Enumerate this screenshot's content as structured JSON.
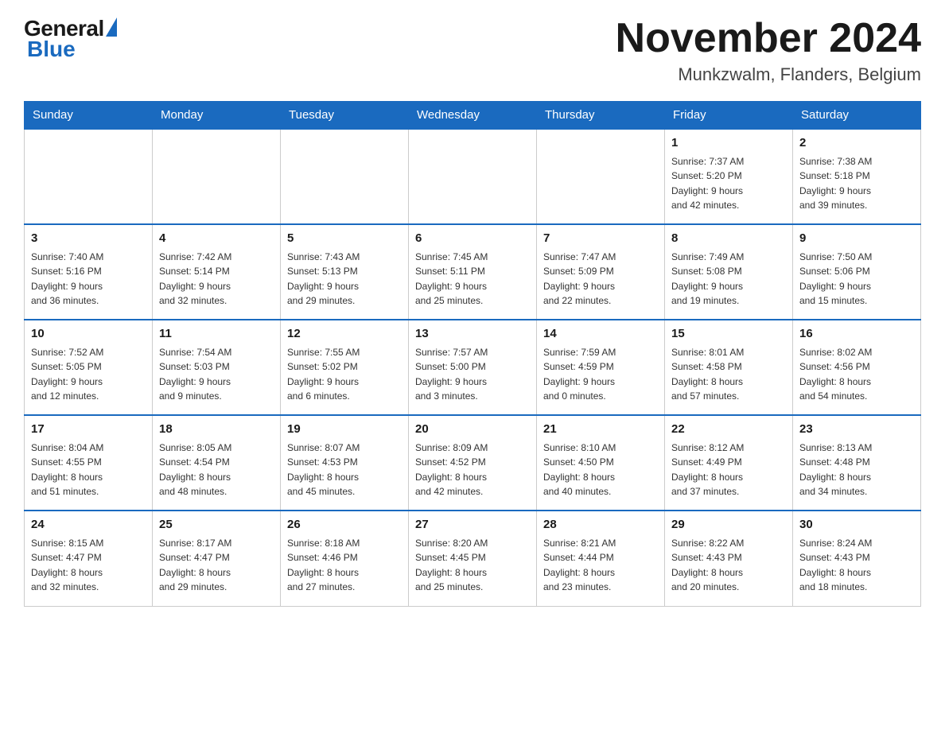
{
  "header": {
    "logo_general": "General",
    "logo_blue": "Blue",
    "month_title": "November 2024",
    "location": "Munkzwalm, Flanders, Belgium"
  },
  "calendar": {
    "days_of_week": [
      "Sunday",
      "Monday",
      "Tuesday",
      "Wednesday",
      "Thursday",
      "Friday",
      "Saturday"
    ],
    "weeks": [
      [
        {
          "day": "",
          "info": ""
        },
        {
          "day": "",
          "info": ""
        },
        {
          "day": "",
          "info": ""
        },
        {
          "day": "",
          "info": ""
        },
        {
          "day": "",
          "info": ""
        },
        {
          "day": "1",
          "info": "Sunrise: 7:37 AM\nSunset: 5:20 PM\nDaylight: 9 hours\nand 42 minutes."
        },
        {
          "day": "2",
          "info": "Sunrise: 7:38 AM\nSunset: 5:18 PM\nDaylight: 9 hours\nand 39 minutes."
        }
      ],
      [
        {
          "day": "3",
          "info": "Sunrise: 7:40 AM\nSunset: 5:16 PM\nDaylight: 9 hours\nand 36 minutes."
        },
        {
          "day": "4",
          "info": "Sunrise: 7:42 AM\nSunset: 5:14 PM\nDaylight: 9 hours\nand 32 minutes."
        },
        {
          "day": "5",
          "info": "Sunrise: 7:43 AM\nSunset: 5:13 PM\nDaylight: 9 hours\nand 29 minutes."
        },
        {
          "day": "6",
          "info": "Sunrise: 7:45 AM\nSunset: 5:11 PM\nDaylight: 9 hours\nand 25 minutes."
        },
        {
          "day": "7",
          "info": "Sunrise: 7:47 AM\nSunset: 5:09 PM\nDaylight: 9 hours\nand 22 minutes."
        },
        {
          "day": "8",
          "info": "Sunrise: 7:49 AM\nSunset: 5:08 PM\nDaylight: 9 hours\nand 19 minutes."
        },
        {
          "day": "9",
          "info": "Sunrise: 7:50 AM\nSunset: 5:06 PM\nDaylight: 9 hours\nand 15 minutes."
        }
      ],
      [
        {
          "day": "10",
          "info": "Sunrise: 7:52 AM\nSunset: 5:05 PM\nDaylight: 9 hours\nand 12 minutes."
        },
        {
          "day": "11",
          "info": "Sunrise: 7:54 AM\nSunset: 5:03 PM\nDaylight: 9 hours\nand 9 minutes."
        },
        {
          "day": "12",
          "info": "Sunrise: 7:55 AM\nSunset: 5:02 PM\nDaylight: 9 hours\nand 6 minutes."
        },
        {
          "day": "13",
          "info": "Sunrise: 7:57 AM\nSunset: 5:00 PM\nDaylight: 9 hours\nand 3 minutes."
        },
        {
          "day": "14",
          "info": "Sunrise: 7:59 AM\nSunset: 4:59 PM\nDaylight: 9 hours\nand 0 minutes."
        },
        {
          "day": "15",
          "info": "Sunrise: 8:01 AM\nSunset: 4:58 PM\nDaylight: 8 hours\nand 57 minutes."
        },
        {
          "day": "16",
          "info": "Sunrise: 8:02 AM\nSunset: 4:56 PM\nDaylight: 8 hours\nand 54 minutes."
        }
      ],
      [
        {
          "day": "17",
          "info": "Sunrise: 8:04 AM\nSunset: 4:55 PM\nDaylight: 8 hours\nand 51 minutes."
        },
        {
          "day": "18",
          "info": "Sunrise: 8:05 AM\nSunset: 4:54 PM\nDaylight: 8 hours\nand 48 minutes."
        },
        {
          "day": "19",
          "info": "Sunrise: 8:07 AM\nSunset: 4:53 PM\nDaylight: 8 hours\nand 45 minutes."
        },
        {
          "day": "20",
          "info": "Sunrise: 8:09 AM\nSunset: 4:52 PM\nDaylight: 8 hours\nand 42 minutes."
        },
        {
          "day": "21",
          "info": "Sunrise: 8:10 AM\nSunset: 4:50 PM\nDaylight: 8 hours\nand 40 minutes."
        },
        {
          "day": "22",
          "info": "Sunrise: 8:12 AM\nSunset: 4:49 PM\nDaylight: 8 hours\nand 37 minutes."
        },
        {
          "day": "23",
          "info": "Sunrise: 8:13 AM\nSunset: 4:48 PM\nDaylight: 8 hours\nand 34 minutes."
        }
      ],
      [
        {
          "day": "24",
          "info": "Sunrise: 8:15 AM\nSunset: 4:47 PM\nDaylight: 8 hours\nand 32 minutes."
        },
        {
          "day": "25",
          "info": "Sunrise: 8:17 AM\nSunset: 4:47 PM\nDaylight: 8 hours\nand 29 minutes."
        },
        {
          "day": "26",
          "info": "Sunrise: 8:18 AM\nSunset: 4:46 PM\nDaylight: 8 hours\nand 27 minutes."
        },
        {
          "day": "27",
          "info": "Sunrise: 8:20 AM\nSunset: 4:45 PM\nDaylight: 8 hours\nand 25 minutes."
        },
        {
          "day": "28",
          "info": "Sunrise: 8:21 AM\nSunset: 4:44 PM\nDaylight: 8 hours\nand 23 minutes."
        },
        {
          "day": "29",
          "info": "Sunrise: 8:22 AM\nSunset: 4:43 PM\nDaylight: 8 hours\nand 20 minutes."
        },
        {
          "day": "30",
          "info": "Sunrise: 8:24 AM\nSunset: 4:43 PM\nDaylight: 8 hours\nand 18 minutes."
        }
      ]
    ]
  }
}
